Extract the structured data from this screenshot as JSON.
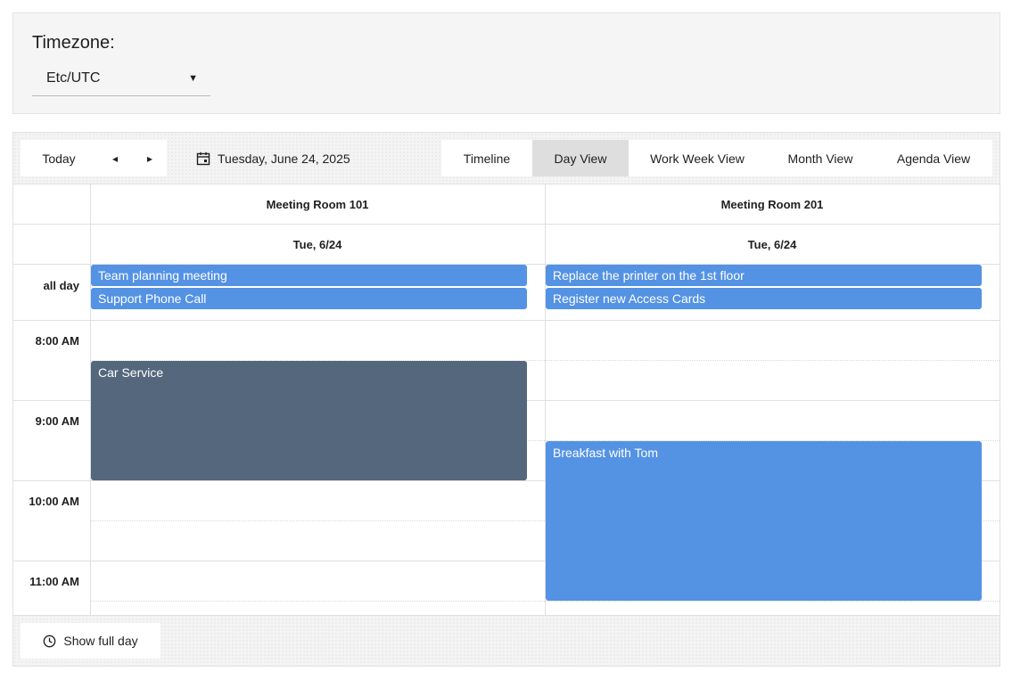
{
  "timezone": {
    "label": "Timezone:",
    "selected": "Etc/UTC",
    "caret": "▼"
  },
  "toolbar": {
    "today": "Today",
    "prev": "◂",
    "next": "▸",
    "date": "Tuesday, June 24, 2025",
    "views": [
      "Timeline",
      "Day View",
      "Work Week View",
      "Month View",
      "Agenda View"
    ],
    "active_view": "Day View"
  },
  "resources": [
    {
      "name": "Meeting Room 101",
      "date": "Tue, 6/24"
    },
    {
      "name": "Meeting Room 201",
      "date": "Tue, 6/24"
    }
  ],
  "allday_label": "all day",
  "times": [
    "8:00 AM",
    "9:00 AM",
    "10:00 AM",
    "11:00 AM"
  ],
  "events": {
    "allday_room101": [
      "Team planning meeting",
      "Support Phone Call"
    ],
    "allday_room201": [
      "Replace the printer on the 1st floor",
      "Register new Access Cards"
    ],
    "car_service": "Car Service",
    "breakfast": "Breakfast with Tom"
  },
  "colors": {
    "event_blue": "#5492e4",
    "event_slate": "#55677d",
    "active_view_bg": "#dedede"
  },
  "footer": {
    "show_full_day": "Show full day",
    "icon": "clock-icon"
  }
}
